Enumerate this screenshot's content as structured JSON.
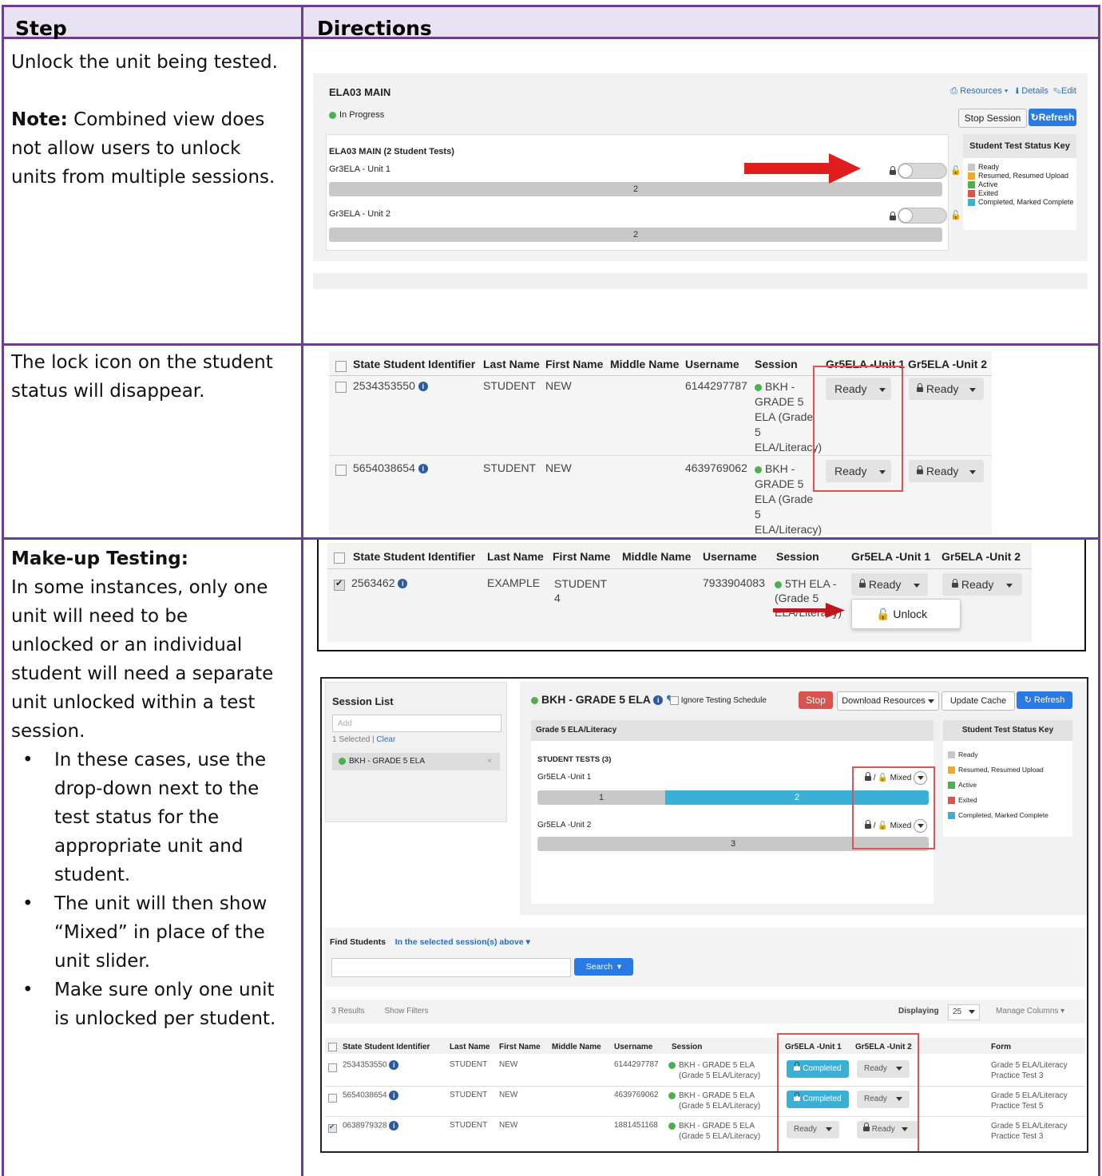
{
  "table": {
    "header": {
      "step": "Step",
      "directions": "Directions"
    },
    "rows": [
      {
        "lines": [
          "Unlock the unit being tested."
        ],
        "note_label": "Note:",
        "note_lines": [
          "Combined view does",
          "not allow users to unlock",
          "units from multiple sessions."
        ]
      },
      {
        "lines": [
          "The lock icon on the student",
          "status will disappear."
        ]
      },
      {
        "title": "Make-up Testing:",
        "lines": [
          "In some instances, only one",
          "unit will need to be",
          "unlocked or an individual",
          "student will need a separate",
          "unit unlocked within a test",
          "session."
        ],
        "bullets": [
          [
            "In these cases, use the",
            "drop-down next to the",
            "test status for the",
            "appropriate unit and",
            "student."
          ],
          [
            "The unit will then show",
            "“Mixed” in place of the",
            "unit slider."
          ],
          [
            "Make sure only one unit",
            "is unlocked per student."
          ]
        ]
      }
    ]
  },
  "shot1": {
    "title": "ELA03 MAIN",
    "status": "In Progress",
    "links": {
      "resources": "Resources",
      "details": "Details",
      "edit": "Edit"
    },
    "stop": "Stop Session",
    "refresh": "Refresh",
    "tests_title": "ELA03 MAIN (2 Student Tests)",
    "units": [
      {
        "name": "Gr3ELA - Unit 1",
        "count": "2"
      },
      {
        "name": "Gr3ELA - Unit 2",
        "count": "2"
      }
    ],
    "key_title": "Student Test Status Key",
    "key": [
      {
        "label": "Ready",
        "color": "#c8c8c8"
      },
      {
        "label": "Resumed, Resumed Upload",
        "color": "#f0a830"
      },
      {
        "label": "Active",
        "color": "#4caf50"
      },
      {
        "label": "Exited",
        "color": "#d9534f"
      },
      {
        "label": "Completed, Marked Complete",
        "color": "#3bb0d6"
      }
    ]
  },
  "shot2": {
    "headers": [
      "State Student Identifier",
      "Last Name",
      "First Name",
      "Middle Name",
      "Username",
      "Session",
      "Gr5ELA -Unit 1",
      "Gr5ELA -Unit 2"
    ],
    "rows": [
      {
        "id": "2534353550",
        "last": "STUDENT",
        "first": "NEW",
        "user": "6144297787",
        "session": [
          "BKH -",
          "GRADE 5",
          "ELA (Grade",
          "5",
          "ELA/Literacy)"
        ],
        "u1": "Ready",
        "u2": "Ready"
      },
      {
        "id": "5654038654",
        "last": "STUDENT",
        "first": "NEW",
        "user": "4639769062",
        "session": [
          "BKH -",
          "GRADE 5",
          "ELA (Grade",
          "5",
          "ELA/Literacy)"
        ],
        "u1": "Ready",
        "u2": "Ready"
      }
    ]
  },
  "shot3": {
    "headers": [
      "State Student Identifier",
      "Last Name",
      "First Name",
      "Middle Name",
      "Username",
      "Session",
      "Gr5ELA -Unit 1",
      "Gr5ELA -Unit 2"
    ],
    "row": {
      "id": "2563462",
      "last": "EXAMPLE",
      "first": "STUDENT",
      "first2": "4",
      "user": "7933904083",
      "session": [
        "5TH ELA -",
        "(Grade 5",
        "ELA/Literacy)"
      ],
      "u1": "Ready",
      "u2": "Ready"
    },
    "menu": "Unlock"
  },
  "shot4": {
    "session_list": "Session List",
    "add_placeholder": "Add",
    "selected": "1 Selected |",
    "clear": "Clear",
    "session_item": "BKH - GRADE 5 ELA",
    "title": "BKH - GRADE 5 ELA",
    "ignore": "Ignore Testing Schedule",
    "stop": "Stop",
    "download": "Download Resources",
    "update": "Update Cache",
    "refresh": "Refresh",
    "subject": "Grade 5 ELA/Literacy",
    "tests": "STUDENT TESTS (3)",
    "units": [
      {
        "name": "Gr5ELA -Unit 1",
        "mixed": "Mixed",
        "seg1": "1",
        "seg2": "2"
      },
      {
        "name": "Gr5ELA -Unit 2",
        "mixed": "Mixed",
        "seg1": "3"
      }
    ],
    "key_title": "Student Test Status Key",
    "key": [
      {
        "label": "Ready",
        "color": "#c8c8c8"
      },
      {
        "label": "Resumed, Resumed Upload",
        "color": "#f0a830"
      },
      {
        "label": "Active",
        "color": "#4caf50"
      },
      {
        "label": "Exited",
        "color": "#d9534f"
      },
      {
        "label": "Completed, Marked Complete",
        "color": "#3bb0d6"
      }
    ],
    "find": "Find Students",
    "scope": "In the selected session(s) above",
    "search": "Search",
    "results": "3 Results",
    "filters": "Show Filters",
    "displaying": "Displaying",
    "per_page": "25",
    "manage": "Manage Columns",
    "headers": [
      "State Student Identifier",
      "Last Name",
      "First Name",
      "Middle Name",
      "Username",
      "Session",
      "Gr5ELA -Unit 1",
      "Gr5ELA -Unit 2",
      "Form"
    ],
    "rows": [
      {
        "id": "2534353550",
        "last": "STUDENT",
        "first": "NEW",
        "user": "6144297787",
        "s1": "BKH - GRADE 5 ELA",
        "s2": "(Grade 5 ELA/Literacy)",
        "u1": "Completed",
        "u2": "Ready",
        "f1": "Grade 5 ELA/Literacy",
        "f2": "Practice Test 3"
      },
      {
        "id": "5654038654",
        "last": "STUDENT",
        "first": "NEW",
        "user": "4639769062",
        "s1": "BKH - GRADE 5 ELA",
        "s2": "(Grade 5 ELA/Literacy)",
        "u1": "Completed",
        "u2": "Ready",
        "f1": "Grade 5 ELA/Literacy",
        "f2": "Practice Test 5"
      },
      {
        "id": "0638979328",
        "last": "STUDENT",
        "first": "NEW",
        "user": "1881451168",
        "s1": "BKH - GRADE 5 ELA",
        "s2": "(Grade 5 ELA/Literacy)",
        "u1": "Ready",
        "u2": "Ready",
        "f1": "Grade 5 ELA/Literacy",
        "f2": "Practice Test 3"
      }
    ]
  }
}
